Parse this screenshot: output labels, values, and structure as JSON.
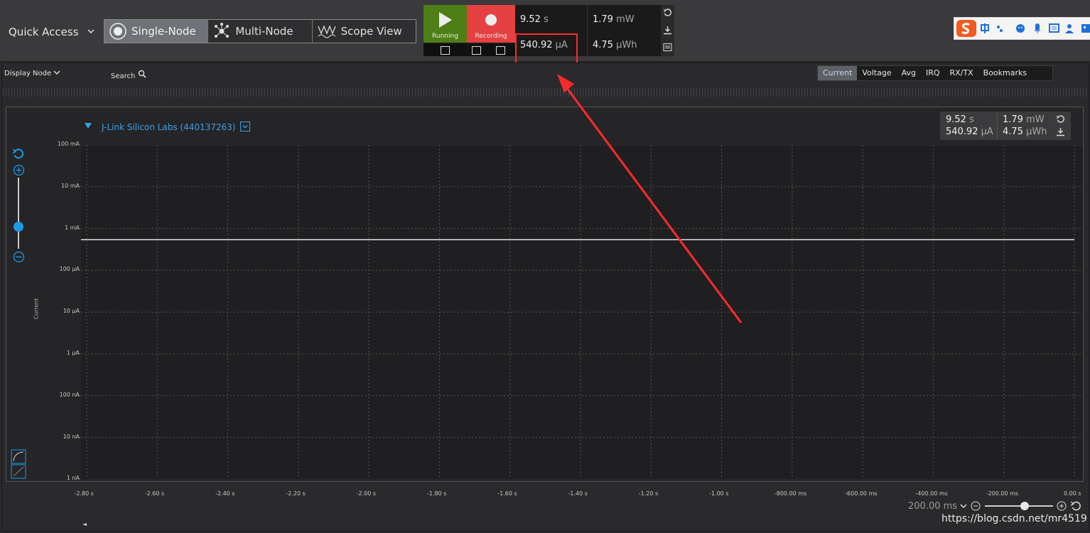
{
  "toolbar": {
    "quick_access": "Quick Access",
    "modes": [
      {
        "label": "Single-Node",
        "icon": "single-node-icon",
        "active": true
      },
      {
        "label": "Multi-Node",
        "icon": "multi-node-icon",
        "active": false
      },
      {
        "label": "Scope View",
        "icon": "scope-view-icon",
        "active": false
      }
    ],
    "run_label": "Running",
    "record_label": "Recording",
    "measurements": {
      "time_value": "9.52",
      "time_unit": "s",
      "power_value": "1.79",
      "power_unit": "mW",
      "current_value": "540.92",
      "current_unit": "µA",
      "energy_value": "4.75",
      "energy_unit": "µWh"
    }
  },
  "panel": {
    "display_node": "Display Node",
    "search": "Search",
    "tabs": [
      {
        "label": "Current",
        "active": true
      },
      {
        "label": "Voltage",
        "active": false
      },
      {
        "label": "Avg",
        "active": false
      },
      {
        "label": "IRQ",
        "active": false
      },
      {
        "label": "RX/TX",
        "active": false
      },
      {
        "label": "Bookmarks",
        "active": false
      }
    ]
  },
  "plot": {
    "device": "J-Link Silicon Labs (440137263)",
    "ylabel": "Current",
    "stats": {
      "time_value": "9.52",
      "time_unit": "s",
      "power_value": "1.79",
      "power_unit": "mW",
      "current_value": "540.92",
      "current_unit": "µA",
      "energy_value": "4.75",
      "energy_unit": "µWh"
    },
    "zoom_label": "200.00 ms"
  },
  "chart_data": {
    "type": "line",
    "title": "",
    "xlabel": "",
    "ylabel": "Current",
    "y_scale": "log",
    "y_ticks": [
      "100 mA",
      "10 mA",
      "1 mA",
      "100 µA",
      "10 µA",
      "1 µA",
      "100 nA",
      "10 nA",
      "1 nA"
    ],
    "x_ticks": [
      "-2.80 s",
      "-2.60 s",
      "-2.40 s",
      "-2.20 s",
      "-2.00 s",
      "-1.80 s",
      "-1.60 s",
      "-1.40 s",
      "-1.20 s",
      "-1.00 s",
      "-800.00 ms",
      "-600.00 ms",
      "-400.00 ms",
      "-200.00 ms",
      "0.00 s"
    ],
    "xlim_s": [
      -2.8,
      0.0
    ],
    "ylim_A": [
      1e-09,
      0.1
    ],
    "grid": true,
    "series": [
      {
        "x_s": [
          -2.82,
          0.0
        ],
        "y_A": [
          0.00054092,
          0.00054092
        ]
      }
    ]
  },
  "watermark": "https://blog.csdn.net/mr4519",
  "colors": {
    "running": "#4e7f16",
    "recording": "#e54143",
    "accent": "#1e9be8",
    "highlight": "#ff2a2a"
  }
}
